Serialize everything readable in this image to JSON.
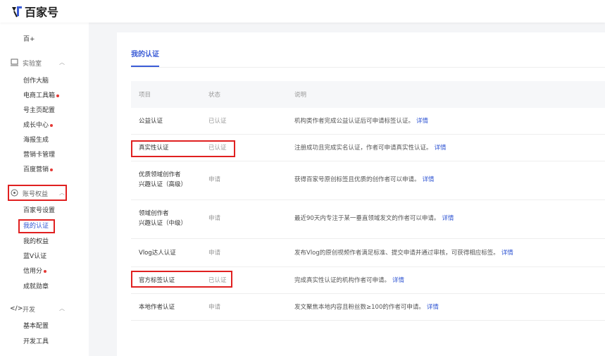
{
  "header": {
    "logo_text": "百家号"
  },
  "sidebar": {
    "partial_top": "百+",
    "groups": [
      {
        "title": "实验室",
        "items": [
          {
            "label": "创作大脑",
            "dot": false
          },
          {
            "label": "电商工具箱",
            "dot": true
          },
          {
            "label": "号主页配置",
            "dot": false
          },
          {
            "label": "成长中心",
            "dot": true
          },
          {
            "label": "海报生成",
            "dot": false
          },
          {
            "label": "营销卡管理",
            "dot": false
          },
          {
            "label": "百度营销",
            "dot": true
          }
        ]
      },
      {
        "title": "账号权益",
        "items": [
          {
            "label": "百家号设置",
            "dot": false
          },
          {
            "label": "我的认证",
            "dot": false,
            "active": true
          },
          {
            "label": "我的权益",
            "dot": false
          },
          {
            "label": "蓝V认证",
            "dot": false
          },
          {
            "label": "信用分",
            "dot": true
          },
          {
            "label": "成就勋章",
            "dot": false
          }
        ]
      },
      {
        "title": "开发",
        "items": [
          {
            "label": "基本配置",
            "dot": false
          },
          {
            "label": "开发工具",
            "dot": false
          }
        ]
      }
    ]
  },
  "main": {
    "title": "我的认证",
    "columns": [
      "项目",
      "状态",
      "说明"
    ],
    "rows": [
      {
        "name": "公益认证",
        "status": "已认证",
        "desc": "机构类作者完成公益认证后可申请标签认证。",
        "link": "详情"
      },
      {
        "name": "真实性认证",
        "status": "已认证",
        "desc": "注册成功且完成实名认证，作者可申请真实性认证。",
        "link": "详情"
      },
      {
        "name": "优质领域创作者\n兴趣认证（高级）",
        "status": "申请",
        "desc": "获得百家号原创标签且优质的创作者可以申请。",
        "link": "详情"
      },
      {
        "name": "领域创作者\n兴趣认证（中级）",
        "status": "申请",
        "desc": "最近90天内专注于某一垂直领域发文的作者可以申请。",
        "link": "详情"
      },
      {
        "name": "Vlog达人认证",
        "status": "申请",
        "desc": "发布Vlog的原创视频作者满足标准、提交申请并通过审核，可获得相应标签。",
        "link": "详情"
      },
      {
        "name": "官方标签认证",
        "status": "已认证",
        "desc": "完成真实性认证的机构作者可申请。",
        "link": "详情"
      },
      {
        "name": "本地作者认证",
        "status": "申请",
        "desc": "发文聚焦本地内容且粉丝数≥100的作者可申请。",
        "link": "详情"
      }
    ]
  },
  "colors": {
    "accent": "#3a5bd6",
    "highlight": "#e02020",
    "dot": "#e53935"
  }
}
